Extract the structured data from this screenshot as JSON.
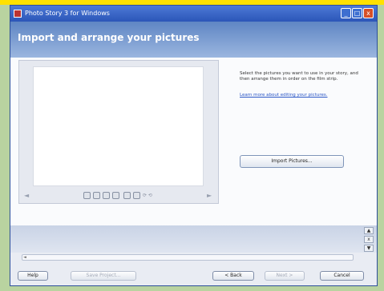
{
  "window": {
    "title": "Photo Story 3 for Windows",
    "minimize_label": "_",
    "maximize_label": "□",
    "close_label": "x"
  },
  "header": {
    "title": "Import and arrange your pictures"
  },
  "preview": {
    "nav_left": "◄",
    "nav_right": "►",
    "tool_text": "⟳ ⟲"
  },
  "instructions": {
    "text": "Select the pictures you want to use in your story, and then arrange them in order on the film strip.",
    "link": "Learn more about editing your pictures."
  },
  "import_button": {
    "label": "Import Pictures..."
  },
  "filmstrip": {
    "up_label": "▲",
    "remove_label": "x",
    "down_label": "▼"
  },
  "scrollbar": {
    "left_arrow": "◄"
  },
  "footer": {
    "help": "Help",
    "save_project": "Save Project...",
    "back": "< Back",
    "next": "Next >",
    "cancel": "Cancel"
  }
}
